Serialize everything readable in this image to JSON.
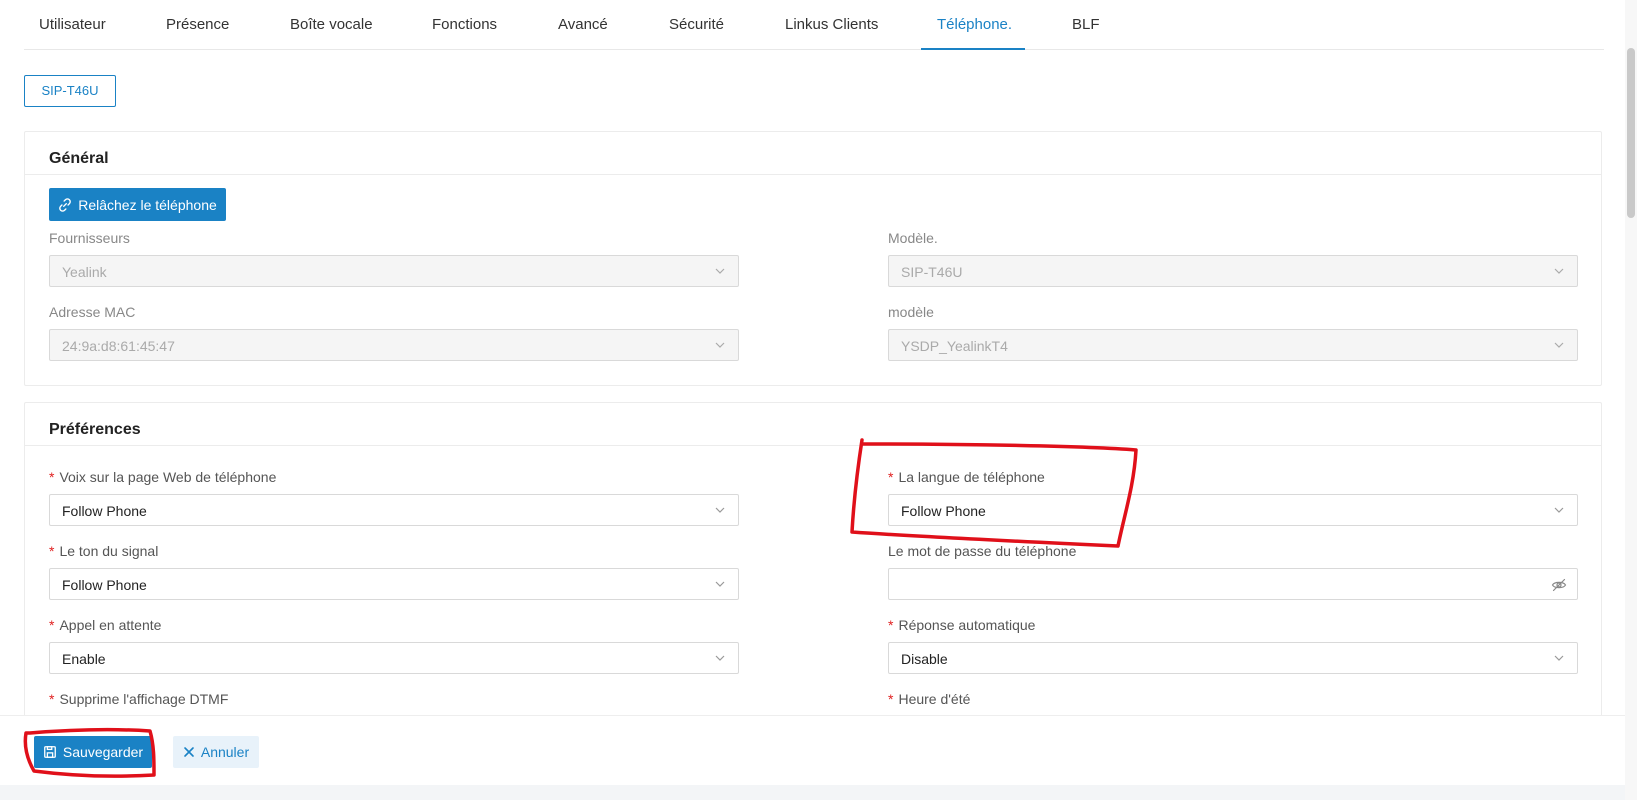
{
  "tabs": [
    {
      "label": "Utilisateur",
      "active": false
    },
    {
      "label": "Présence",
      "active": false
    },
    {
      "label": "Boîte vocale",
      "active": false
    },
    {
      "label": "Fonctions",
      "active": false
    },
    {
      "label": "Avancé",
      "active": false
    },
    {
      "label": "Sécurité",
      "active": false
    },
    {
      "label": "Linkus Clients",
      "active": false
    },
    {
      "label": "Téléphone.",
      "active": true
    },
    {
      "label": "BLF",
      "active": false
    }
  ],
  "device_button": "SIP-T46U",
  "general": {
    "title": "Général",
    "release_button": "Relâchez le téléphone",
    "vendor_label": "Fournisseurs",
    "vendor_value": "Yealink",
    "model_label": "Modèle.",
    "model_value": "SIP-T46U",
    "mac_label": "Adresse MAC",
    "mac_value": "24:9a:d8:61:45:47",
    "template_label": "modèle",
    "template_value": "YSDP_YealinkT4"
  },
  "preferences": {
    "title": "Préférences",
    "fields": {
      "web_voice_label": "Voix sur la page Web de téléphone",
      "web_voice_value": "Follow Phone",
      "phone_language_label": "La langue de téléphone",
      "phone_language_value": "Follow Phone",
      "signal_tone_label": "Le ton du signal",
      "signal_tone_value": "Follow Phone",
      "phone_password_label": "Le mot de passe du téléphone",
      "phone_password_value": "",
      "call_waiting_label": "Appel en attente",
      "call_waiting_value": "Enable",
      "auto_answer_label": "Réponse automatique",
      "auto_answer_value": "Disable",
      "dtmf_label": "Supprime l'affichage DTMF",
      "dst_label": "Heure d'été"
    }
  },
  "footer": {
    "save_label": "Sauvegarder",
    "cancel_label": "Annuler"
  },
  "colors": {
    "accent": "#1a82c5",
    "required": "#e02020",
    "annotation": "#e0101a"
  },
  "icons": [
    "unlink-icon",
    "chevron-down-icon",
    "eye-off-icon",
    "save-icon",
    "close-icon"
  ]
}
